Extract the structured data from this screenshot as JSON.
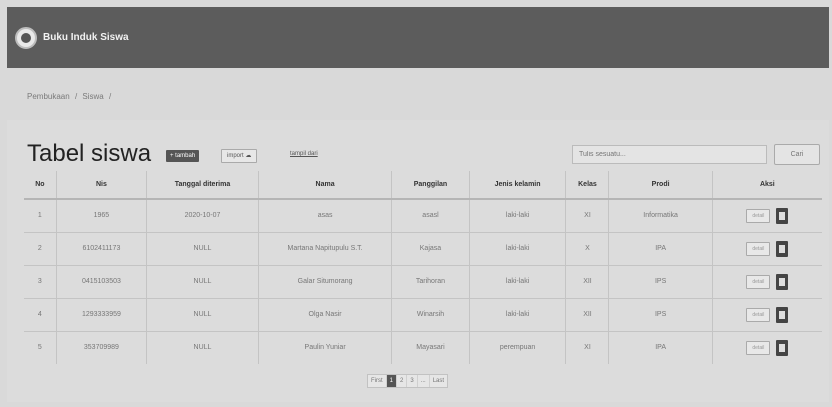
{
  "app": {
    "title": "Buku Induk Siswa"
  },
  "breadcrumb": [
    "Pembukaan",
    "/",
    "Siswa",
    "/"
  ],
  "page": {
    "title": "Tabel siswa",
    "add_label": "+ tambah",
    "import_label": "import",
    "all_link": "tampil dari",
    "search_placeholder": "Tulis sesuatu...",
    "search_button": "Cari"
  },
  "table": {
    "headers": [
      "No",
      "Nis",
      "Tanggal diterima",
      "Nama",
      "Panggilan",
      "Jenis kelamin",
      "Kelas",
      "Prodi",
      "Aksi"
    ],
    "rows": [
      [
        "1",
        "1965",
        "2020-10-07",
        "asas",
        "asasl",
        "laki-laki",
        "XI",
        "Informatika"
      ],
      [
        "2",
        "6102411173",
        "NULL",
        "Martana Napitupulu S.T.",
        "Kajasa",
        "laki-laki",
        "X",
        "IPA"
      ],
      [
        "3",
        "0415103503",
        "NULL",
        "Galar Situmorang",
        "Tarihoran",
        "laki-laki",
        "XII",
        "IPS"
      ],
      [
        "4",
        "1293333959",
        "NULL",
        "Olga Nasir",
        "Winarsih",
        "laki-laki",
        "XII",
        "IPS"
      ],
      [
        "5",
        "353709989",
        "NULL",
        "Paulin Yuniar",
        "Mayasari",
        "perempuan",
        "XI",
        "IPA"
      ]
    ],
    "detail_label": "detail"
  },
  "pagination": [
    "First",
    "1",
    "2",
    "3",
    "...",
    "Last"
  ],
  "pagination_active": "1"
}
